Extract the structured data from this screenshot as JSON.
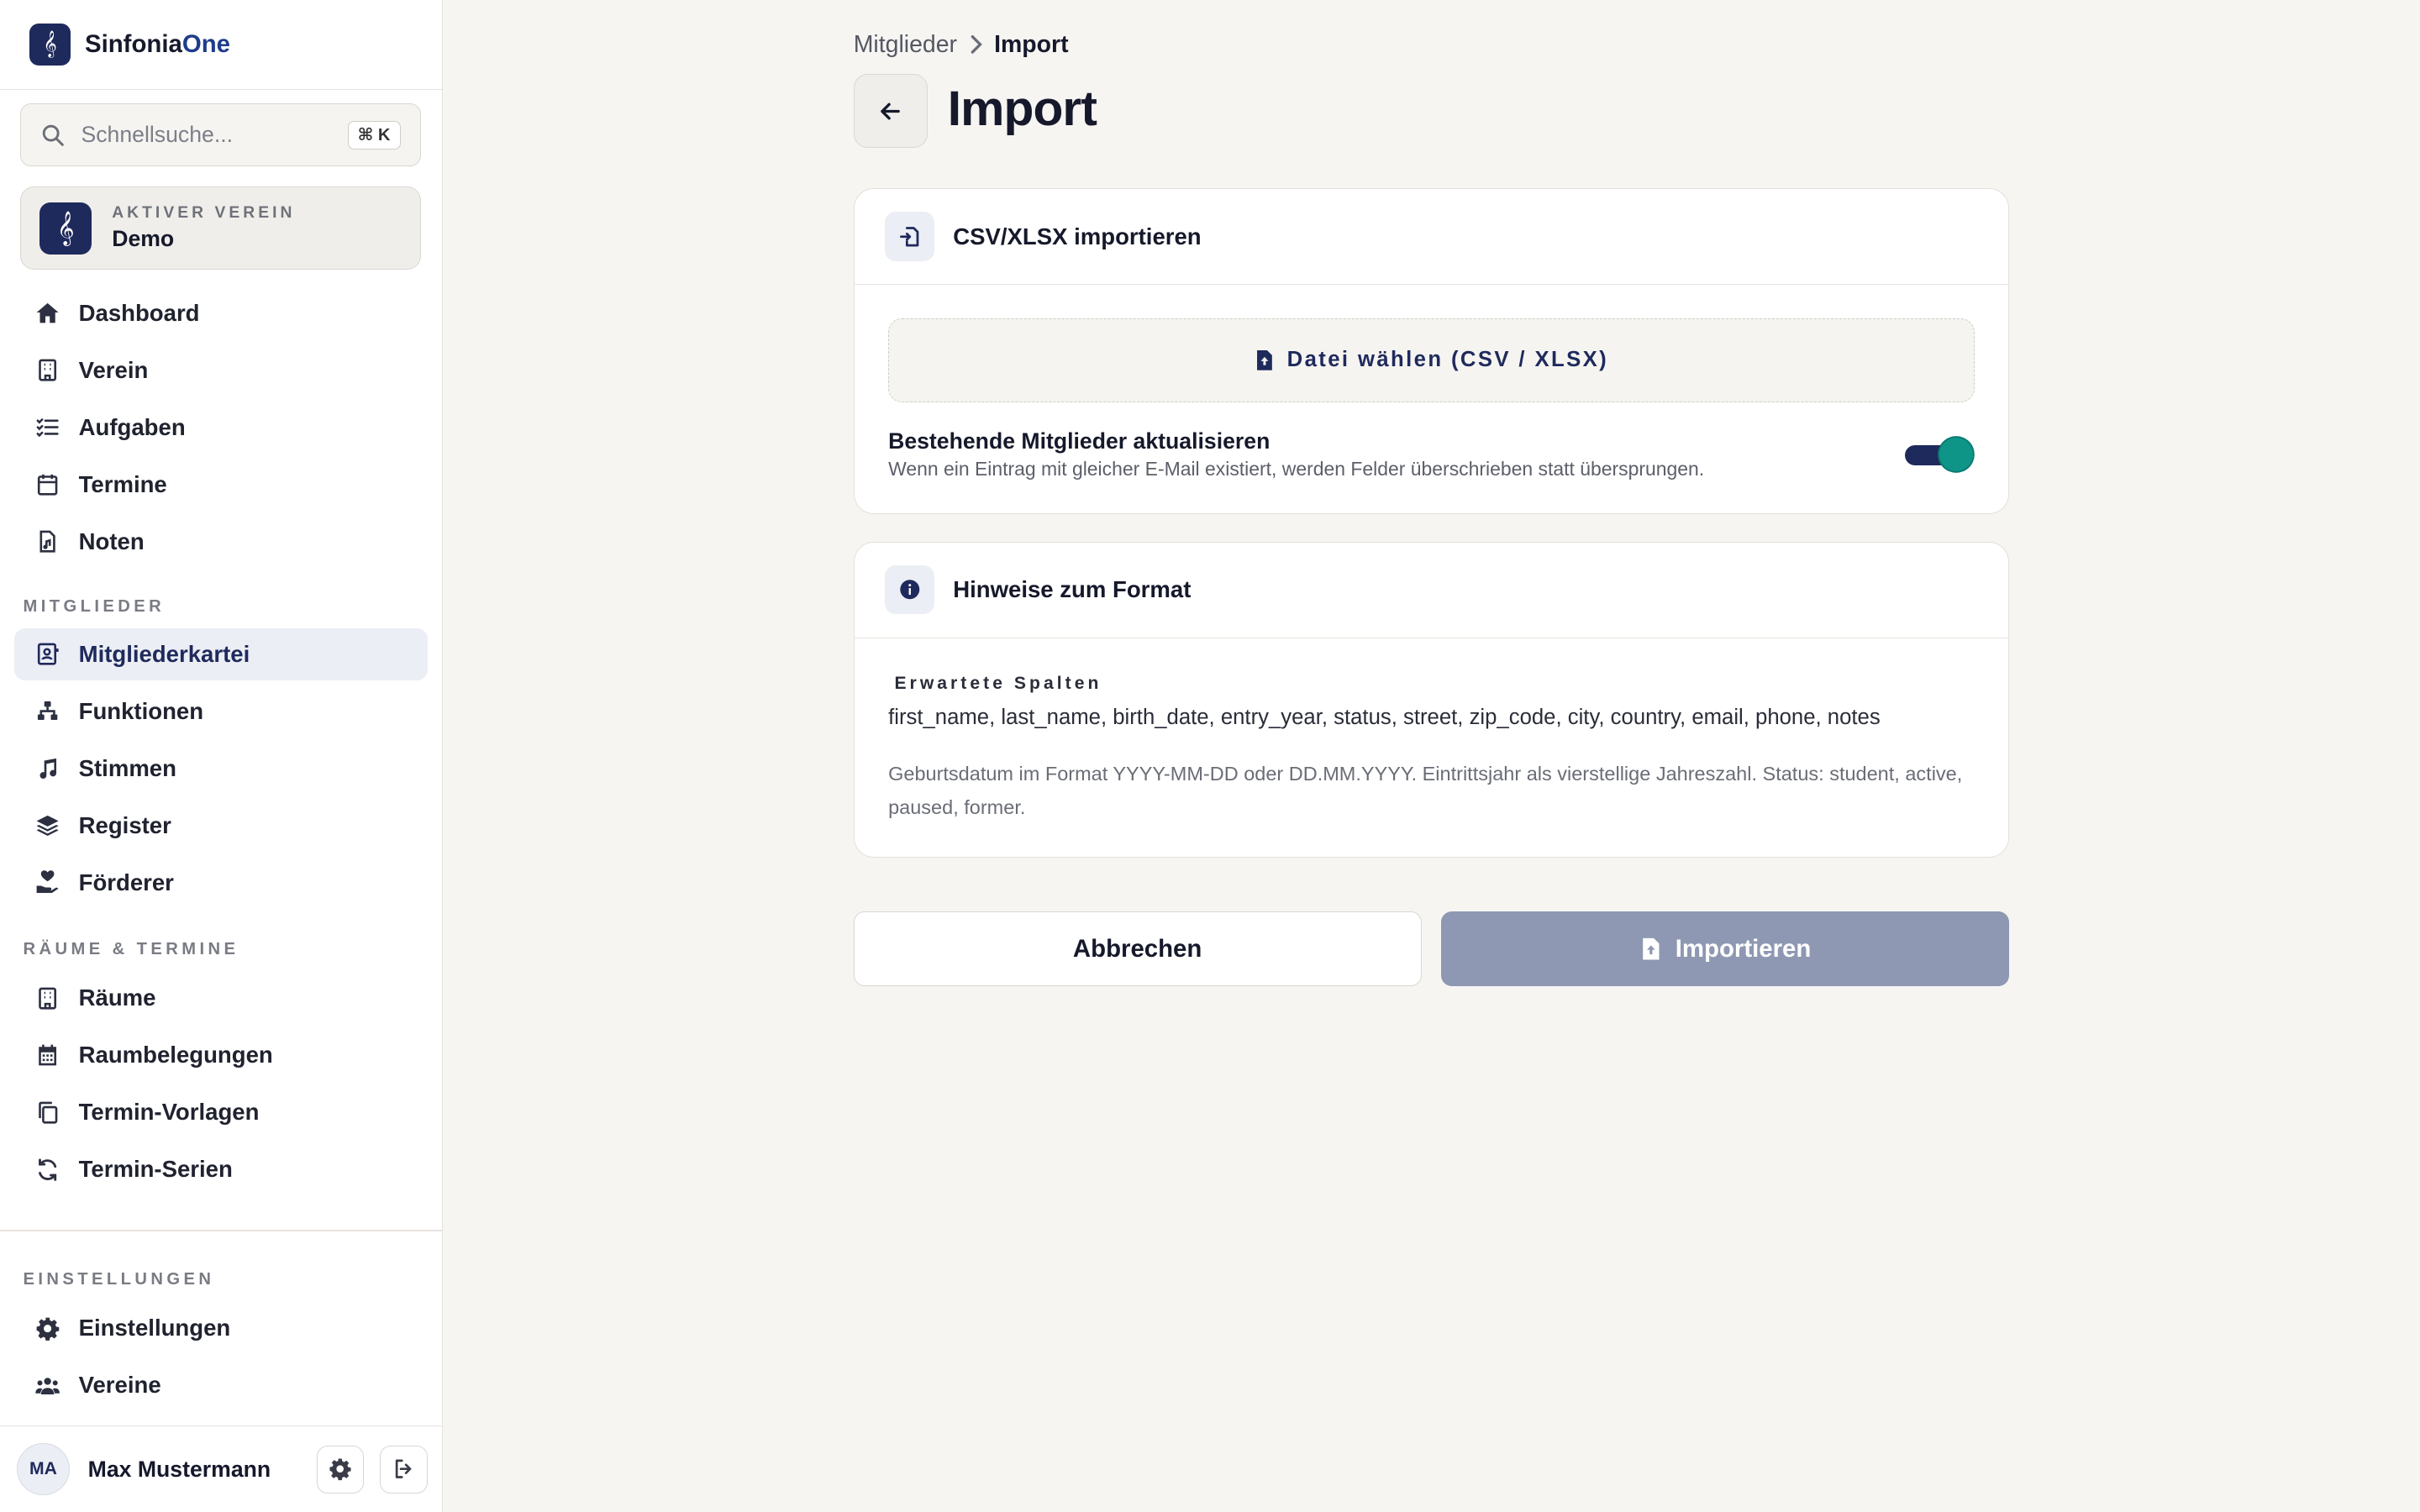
{
  "brand": {
    "name_part1": "Sinfonia",
    "name_part2": "One"
  },
  "search": {
    "placeholder": "Schnellsuche...",
    "shortcut": "⌘ K"
  },
  "active_club": {
    "label": "AKTIVER VEREIN",
    "name": "Demo"
  },
  "nav": {
    "main": [
      {
        "label": "Dashboard",
        "icon": "home-icon"
      },
      {
        "label": "Verein",
        "icon": "building-icon"
      },
      {
        "label": "Aufgaben",
        "icon": "list-check-icon"
      },
      {
        "label": "Termine",
        "icon": "calendar-icon"
      },
      {
        "label": "Noten",
        "icon": "sheet-music-file-icon"
      }
    ],
    "members_section": "MITGLIEDER",
    "members": [
      {
        "label": "Mitgliederkartei",
        "icon": "id-card-icon",
        "active": true
      },
      {
        "label": "Funktionen",
        "icon": "org-chart-icon"
      },
      {
        "label": "Stimmen",
        "icon": "music-note-icon"
      },
      {
        "label": "Register",
        "icon": "layers-icon"
      },
      {
        "label": "Förderer",
        "icon": "hand-heart-icon"
      }
    ],
    "rooms_section": "RÄUME & TERMINE",
    "rooms": [
      {
        "label": "Räume",
        "icon": "building-icon"
      },
      {
        "label": "Raumbelegungen",
        "icon": "calendar-grid-icon"
      },
      {
        "label": "Termin-Vorlagen",
        "icon": "copy-icon"
      },
      {
        "label": "Termin-Serien",
        "icon": "refresh-icon"
      }
    ],
    "settings_section": "EINSTELLUNGEN",
    "settings": [
      {
        "label": "Einstellungen",
        "icon": "gear-icon"
      },
      {
        "label": "Vereine",
        "icon": "users-icon"
      }
    ]
  },
  "user": {
    "initials": "MA",
    "name": "Max Mustermann"
  },
  "breadcrumb": {
    "parent": "Mitglieder",
    "current": "Import"
  },
  "page": {
    "title": "Import"
  },
  "import_card": {
    "title": "CSV/XLSX importieren",
    "file_button": "Datei wählen (CSV / XLSX)",
    "update_title": "Bestehende Mitglieder aktualisieren",
    "update_desc": "Wenn ein Eintrag mit gleicher E-Mail existiert, werden Felder überschrieben statt übersprungen.",
    "update_enabled": true
  },
  "format_card": {
    "title": "Hinweise zum Format",
    "columns_label": "Erwartete Spalten",
    "columns": "first_name, last_name, birth_date, entry_year, status, street, zip_code, city, country, email, phone, notes",
    "notes": "Geburtsdatum im Format YYYY-MM-DD oder DD.MM.YYYY. Eintrittsjahr als vierstellige Jahreszahl. Status: student, active, paused, former."
  },
  "actions": {
    "cancel": "Abbrechen",
    "import": "Importieren"
  },
  "colors": {
    "brand": "#1f2a5c",
    "toggle_knob": "#0f9488",
    "import_disabled": "#8e98b2",
    "background": "#f6f5f2"
  }
}
